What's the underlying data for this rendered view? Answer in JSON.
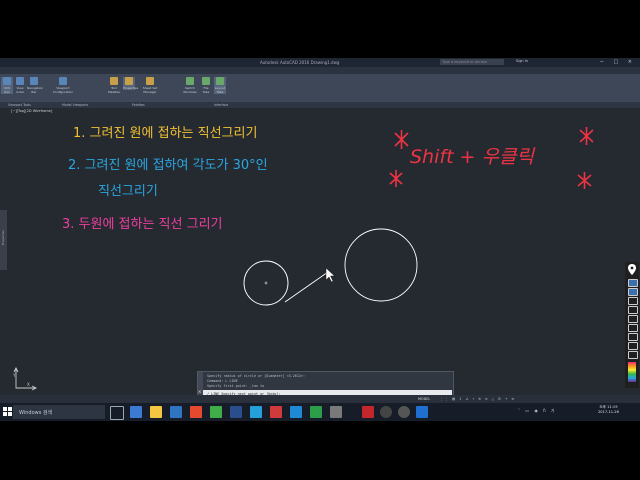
{
  "title_bar": {
    "app_title": "Autodesk AutoCAD 2016   Drawing1.dwg",
    "search_placeholder": "Type a keyword or phrase",
    "sign_in": "Sign In",
    "window_controls": "− □ ×"
  },
  "ribbon_tabs": [
    "Home",
    "Insert",
    "Annotate",
    "Parametric",
    "View",
    "Manage",
    "Output",
    "Add-ins",
    "A360",
    "Express Tools",
    "Featured Apps",
    "BIM 360",
    "Performance",
    "Vault"
  ],
  "ribbon_active_tab_index": 4,
  "ribbon_buttons": {
    "ucs_icon": "UCS Icon",
    "view_cube": "View Cube",
    "navigation_bar": "Navigation Bar",
    "viewport_configuration": "Viewport Configuration",
    "tool_palettes": "Tool Palettes",
    "properties": "Properties",
    "sheet_set_manager": "Sheet Set Manager",
    "switch_windows": "Switch Windows",
    "file_tabs": "File Tabs",
    "layout_tabs": "Layout Tabs",
    "named": "Named",
    "join": "Join",
    "restore": "Restore",
    "tile_horizontally": "Tile Horizontally",
    "tile_vertically": "Tile Vertically",
    "cascade": "Cascade"
  },
  "ribbon_panels": [
    "Viewport Tools",
    "Model Viewports",
    "Palettes",
    "Interface"
  ],
  "viewport_label": "[−][Top][2D Wireframe]",
  "left_palette_label": "Properties",
  "annotations": {
    "line1": "1. 그려진 원에   접하는   직선그리기",
    "line2a": "2.  그려진   원에   접하여   각도가  30°인",
    "line2b": "직선그리기",
    "line3": "3.  두원에   접하는   직선 그리기",
    "tip": "Shift  +  우클릭",
    "colors": {
      "orange": "#f2c232",
      "cyan": "#2aa6e0",
      "pink": "#ee3ea0",
      "red": "#ee3344"
    }
  },
  "command_line": {
    "history": [
      "Specify radius of circle or [Diameter] <3.2612>:",
      "Command: L LINE",
      "Specify first point: _tan to"
    ],
    "prompt": "∕ LINE Specify next point or [Undo]:"
  },
  "layout_tabs": [
    "Model",
    "Layout1",
    "Layout2",
    "+"
  ],
  "layout_active_index": 0,
  "status": {
    "model": "MODEL",
    "icons": "⋮⋮ ▦ ↧ ∠ ⌖ ⊕ ≡ △ ⚙ + ≡"
  },
  "taskbar": {
    "search_text": "Windows 검색",
    "tray": "˄ ▭ ◉ ɦ 가",
    "time": "오후 11:19",
    "date": "2017-11-26"
  }
}
